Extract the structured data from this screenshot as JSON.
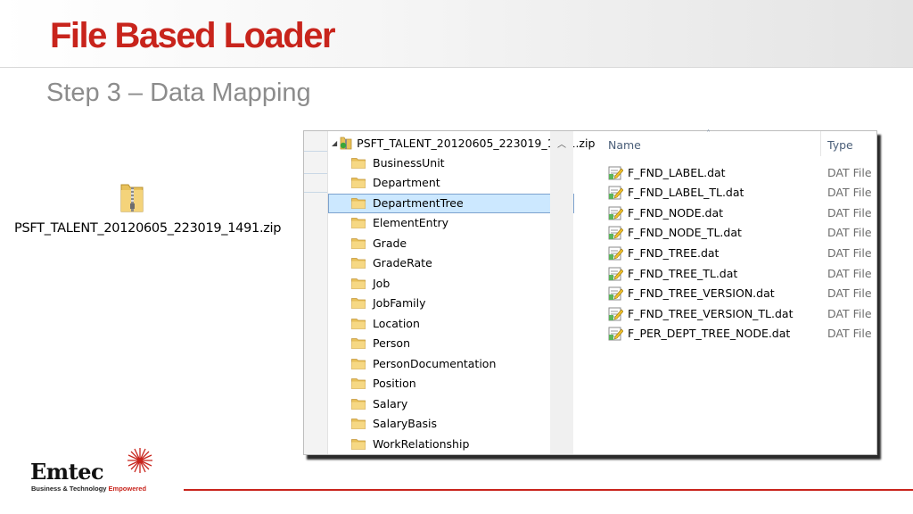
{
  "slide": {
    "title": "File Based Loader",
    "subtitle": "Step 3 – Data Mapping"
  },
  "desktop_icon": {
    "icon": "zip-folder-icon",
    "label": "PSFT_TALENT_20120605_223019_1491.zip"
  },
  "explorer": {
    "tree": {
      "root_label": "PSFT_TALENT_20120605_223019_1491.zip",
      "root_icon": "zip-folder-icon",
      "selected": "DepartmentTree",
      "folders": [
        {
          "label": "BusinessUnit"
        },
        {
          "label": "Department"
        },
        {
          "label": "DepartmentTree"
        },
        {
          "label": "ElementEntry"
        },
        {
          "label": "Grade"
        },
        {
          "label": "GradeRate"
        },
        {
          "label": "Job"
        },
        {
          "label": "JobFamily"
        },
        {
          "label": "Location"
        },
        {
          "label": "Person"
        },
        {
          "label": "PersonDocumentation"
        },
        {
          "label": "Position"
        },
        {
          "label": "Salary"
        },
        {
          "label": "SalaryBasis"
        },
        {
          "label": "WorkRelationship"
        }
      ]
    },
    "columns": {
      "name": "Name",
      "type": "Type"
    },
    "files": [
      {
        "name": "F_FND_LABEL.dat",
        "type": "DAT File"
      },
      {
        "name": "F_FND_LABEL_TL.dat",
        "type": "DAT File"
      },
      {
        "name": "F_FND_NODE.dat",
        "type": "DAT File"
      },
      {
        "name": "F_FND_NODE_TL.dat",
        "type": "DAT File"
      },
      {
        "name": "F_FND_TREE.dat",
        "type": "DAT File"
      },
      {
        "name": "F_FND_TREE_TL.dat",
        "type": "DAT File"
      },
      {
        "name": "F_FND_TREE_VERSION.dat",
        "type": "DAT File"
      },
      {
        "name": "F_FND_TREE_VERSION_TL.dat",
        "type": "DAT File"
      },
      {
        "name": "F_PER_DEPT_TREE_NODE.dat",
        "type": "DAT File"
      }
    ]
  },
  "footer": {
    "logo": "Emtec",
    "tagline_prefix": "Business & Technology ",
    "tagline_accent": "Empowered"
  },
  "colors": {
    "brand_red": "#c8241c",
    "subtitle_gray": "#8c8c8c",
    "selection": "#cce8ff",
    "folder_yellow": "#e8c15a"
  }
}
